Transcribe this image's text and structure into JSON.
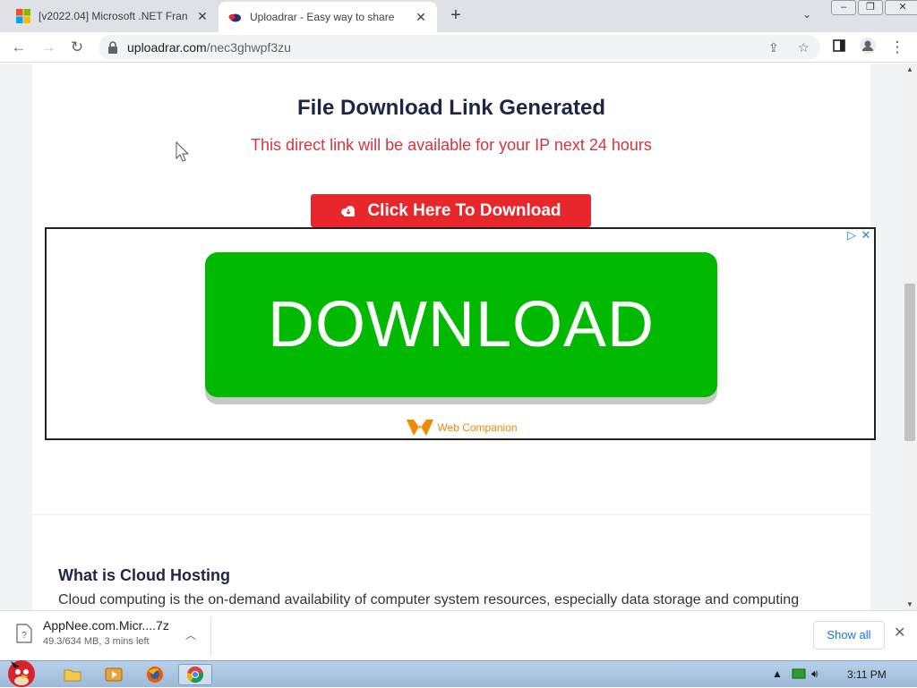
{
  "browser": {
    "tabs": [
      {
        "title": "[v2022.04] Microsoft .NET Fran",
        "active": false
      },
      {
        "title": "Uploadrar - Easy way to share",
        "active": true
      }
    ],
    "new_tab_icon": "plus-icon",
    "window_controls": [
      "minimize",
      "restore",
      "close"
    ],
    "url_host": "uploadrar.com",
    "url_path": "/nec3ghwpf3zu"
  },
  "page": {
    "headline": "File Download Link Generated",
    "subline": "This direct link will be available for your IP next 24 hours",
    "download_button": "Click Here To Download",
    "ad": {
      "big_button": "DOWNLOAD",
      "brand": "Web Companion"
    },
    "section_title": "What is Cloud Hosting",
    "section_body": "Cloud computing is the on-demand availability of computer system resources, especially data storage and computing"
  },
  "download_bar": {
    "filename": "AppNee.com.Micr....7z",
    "status": "49.3/634 MB, 3 mins left",
    "show_all": "Show all"
  },
  "taskbar": {
    "clock": "3:11 PM"
  },
  "colors": {
    "accent_red": "#e8262b",
    "ad_green": "#00b900",
    "headline": "#1f2544"
  }
}
